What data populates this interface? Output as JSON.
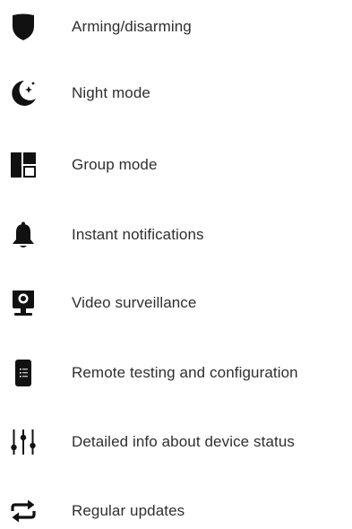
{
  "features": {
    "items": [
      {
        "label": "Arming/disarming",
        "icon": "shield-icon"
      },
      {
        "label": "Night mode",
        "icon": "moon-icon"
      },
      {
        "label": "Group mode",
        "icon": "group-layout-icon"
      },
      {
        "label": "Instant notifications",
        "icon": "bell-icon"
      },
      {
        "label": "Video surveillance",
        "icon": "camera-icon"
      },
      {
        "label": "Remote testing and configuration",
        "icon": "smartphone-icon"
      },
      {
        "label": "Detailed info about device status",
        "icon": "sliders-icon"
      },
      {
        "label": "Regular updates",
        "icon": "repeat-icon"
      }
    ]
  },
  "colors": {
    "icon": "#111111",
    "text": "#2f2f2f",
    "background": "#ffffff"
  }
}
